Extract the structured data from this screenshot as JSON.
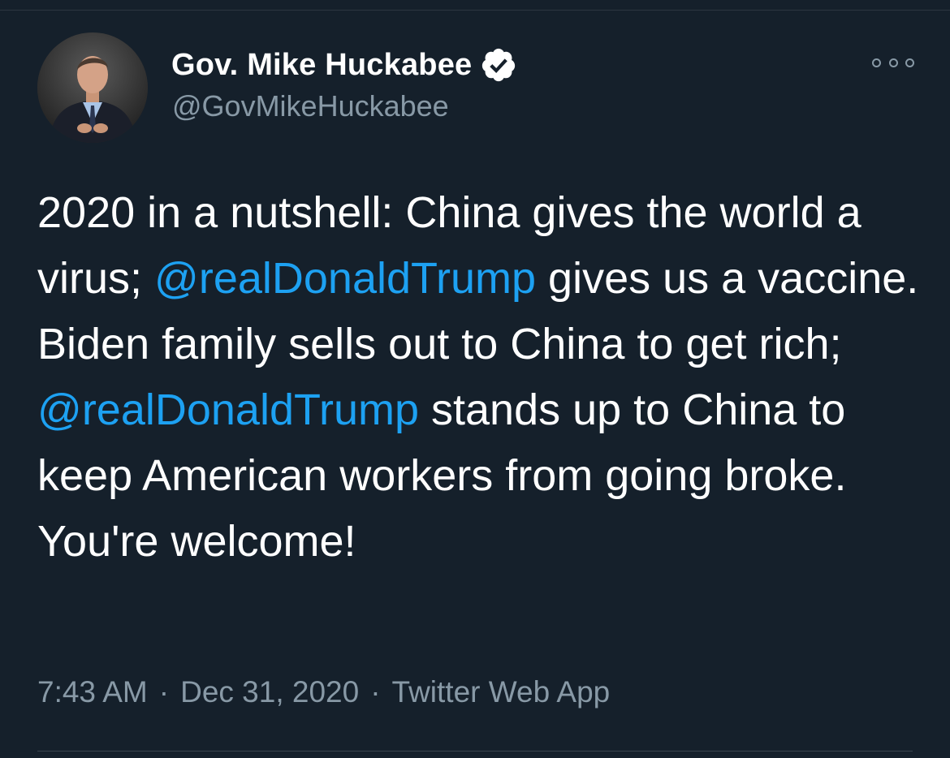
{
  "tweet": {
    "author": {
      "display_name": "Gov. Mike Huckabee",
      "handle": "@GovMikeHuckabee",
      "verified": true,
      "avatar_icon": "profile-photo"
    },
    "text_segments": [
      {
        "text": "2020 in a nutshell: China gives the world a virus; ",
        "type": "text"
      },
      {
        "text": "@realDonaldTrump",
        "type": "mention"
      },
      {
        "text": " gives us a vaccine. Biden family sells out to China to get rich; ",
        "type": "text"
      },
      {
        "text": "@realDonaldTrump",
        "type": "mention"
      },
      {
        "text": " stands up to China to keep American workers from going broke. You're welcome!",
        "type": "text"
      }
    ],
    "time": "7:43 AM",
    "date": "Dec 31, 2020",
    "source": "Twitter Web App",
    "separator": "·",
    "more_icon": "more-options-icon"
  },
  "colors": {
    "background": "#15202b",
    "text": "#ffffff",
    "secondary": "#8899a6",
    "accent": "#1da1f2"
  }
}
